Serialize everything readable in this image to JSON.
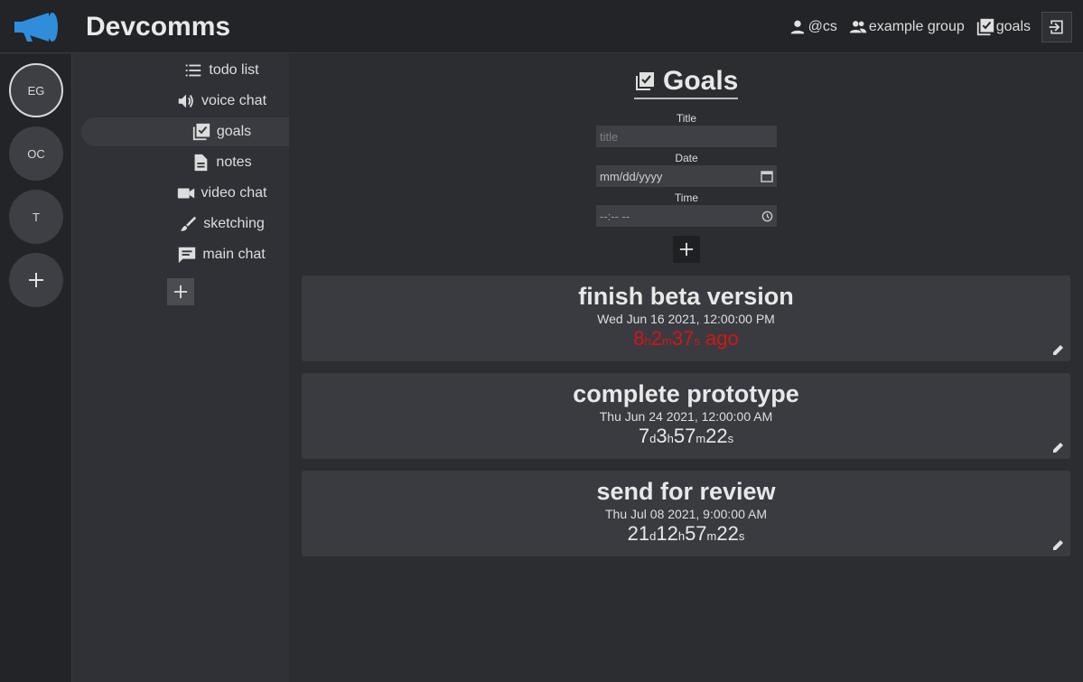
{
  "app": {
    "title": "Devcomms"
  },
  "top_nav": [
    {
      "icon": "user-icon",
      "label": "@cs"
    },
    {
      "icon": "group-icon",
      "label": "example group"
    },
    {
      "icon": "goals-icon",
      "label": "goals"
    }
  ],
  "servers": [
    {
      "label": "EG",
      "active": true
    },
    {
      "label": "OC",
      "active": false
    },
    {
      "label": "T",
      "active": false
    },
    {
      "label": "+",
      "active": false
    }
  ],
  "channels": [
    {
      "icon": "list-icon",
      "label": "todo list"
    },
    {
      "icon": "speaker-icon",
      "label": "voice chat"
    },
    {
      "icon": "goals-icon",
      "label": "goals",
      "active": true
    },
    {
      "icon": "document-icon",
      "label": "notes"
    },
    {
      "icon": "video-icon",
      "label": "video chat"
    },
    {
      "icon": "brush-icon",
      "label": "sketching"
    },
    {
      "icon": "chat-icon",
      "label": "main chat"
    }
  ],
  "goals_page": {
    "heading": "Goals",
    "form": {
      "title_label": "Title",
      "title_placeholder": "title",
      "date_label": "Date",
      "date_value": "mm/dd/yyyy",
      "time_label": "Time",
      "time_value": "--:-- --"
    }
  },
  "goals": [
    {
      "title": "finish beta version",
      "date": "Wed Jun 16 2021, 12:00:00 PM",
      "overdue": true,
      "countdown": [
        [
          "8",
          "h"
        ],
        [
          "2",
          "m"
        ],
        [
          "37",
          "s"
        ]
      ],
      "suffix": " ago"
    },
    {
      "title": "complete prototype",
      "date": "Thu Jun 24 2021, 12:00:00 AM",
      "overdue": false,
      "countdown": [
        [
          "7",
          "d"
        ],
        [
          "3",
          "h"
        ],
        [
          "57",
          "m"
        ],
        [
          "22",
          "s"
        ]
      ],
      "suffix": ""
    },
    {
      "title": "send for review",
      "date": "Thu Jul 08 2021, 9:00:00 AM",
      "overdue": false,
      "countdown": [
        [
          "21",
          "d"
        ],
        [
          "12",
          "h"
        ],
        [
          "57",
          "m"
        ],
        [
          "22",
          "s"
        ]
      ],
      "suffix": ""
    }
  ],
  "colors": {
    "accent": "#2f8ddb",
    "overdue": "#d11616"
  }
}
